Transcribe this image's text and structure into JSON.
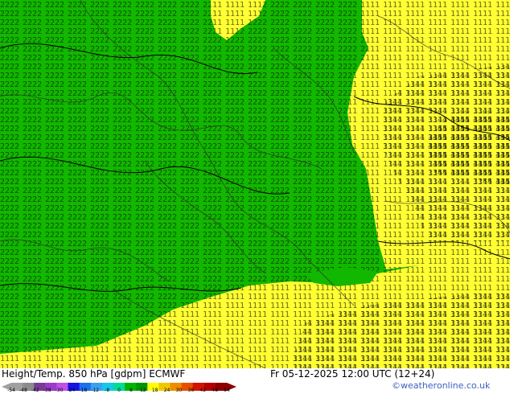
{
  "map": {
    "field_colors": {
      "green": "#12b700",
      "yellow": "#ffff33",
      "contour": "#000000",
      "border": "#2f2f2f"
    }
  },
  "footer": {
    "title": "Height/Temp. 850 hPa [gdpm] ECMWF",
    "datetime": "Fr 05-12-2025 12:00 UTC (12+24)",
    "credit": "©weatheronline.co.uk"
  },
  "colorbar": {
    "ticks": [
      "-54",
      "-48",
      "-42",
      "-38",
      "-30",
      "-24",
      "-18",
      "-12",
      "-8",
      "0",
      "8",
      "12",
      "18",
      "24",
      "30",
      "36",
      "42",
      "48",
      "54"
    ],
    "colors": [
      "#a0a0a0",
      "#8c8c8c",
      "#783c96",
      "#9a3cc8",
      "#c050e6",
      "#1414e6",
      "#1e6ef0",
      "#3ca0f0",
      "#14c8e6",
      "#00dc96",
      "#00b400",
      "#009600",
      "#ffff00",
      "#f0c800",
      "#f08c00",
      "#e65000",
      "#d21400",
      "#b40000",
      "#8c0000"
    ]
  }
}
